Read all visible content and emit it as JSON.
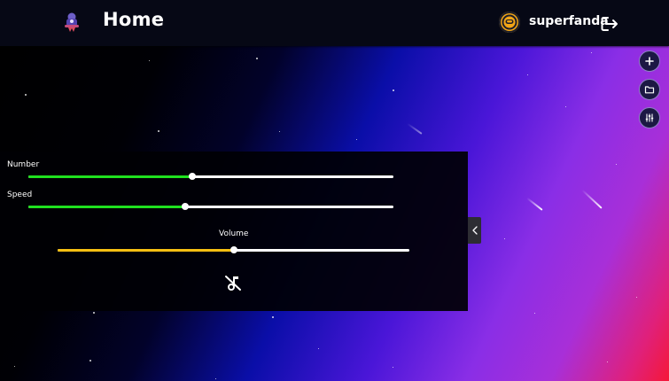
{
  "header": {
    "title": "Home",
    "username": "superfanda"
  },
  "controls": {
    "number": {
      "label": "Number",
      "value_fraction": 0.45
    },
    "speed": {
      "label": "Speed",
      "value_fraction": 0.43
    },
    "volume": {
      "label": "Volume",
      "value_fraction": 0.5
    }
  },
  "colors": {
    "number_fill": "#1fe21f",
    "speed_fill": "#1fe21f",
    "volume_fill": "#f5bf12",
    "avatar": "#f2a516"
  },
  "icons": {
    "logo": "rocket-icon",
    "logout": "logout-icon",
    "add": "plus-icon",
    "folder": "folder-icon",
    "settings": "sliders-icon",
    "collapse": "chevron-left-icon",
    "music": "music-off-icon"
  }
}
